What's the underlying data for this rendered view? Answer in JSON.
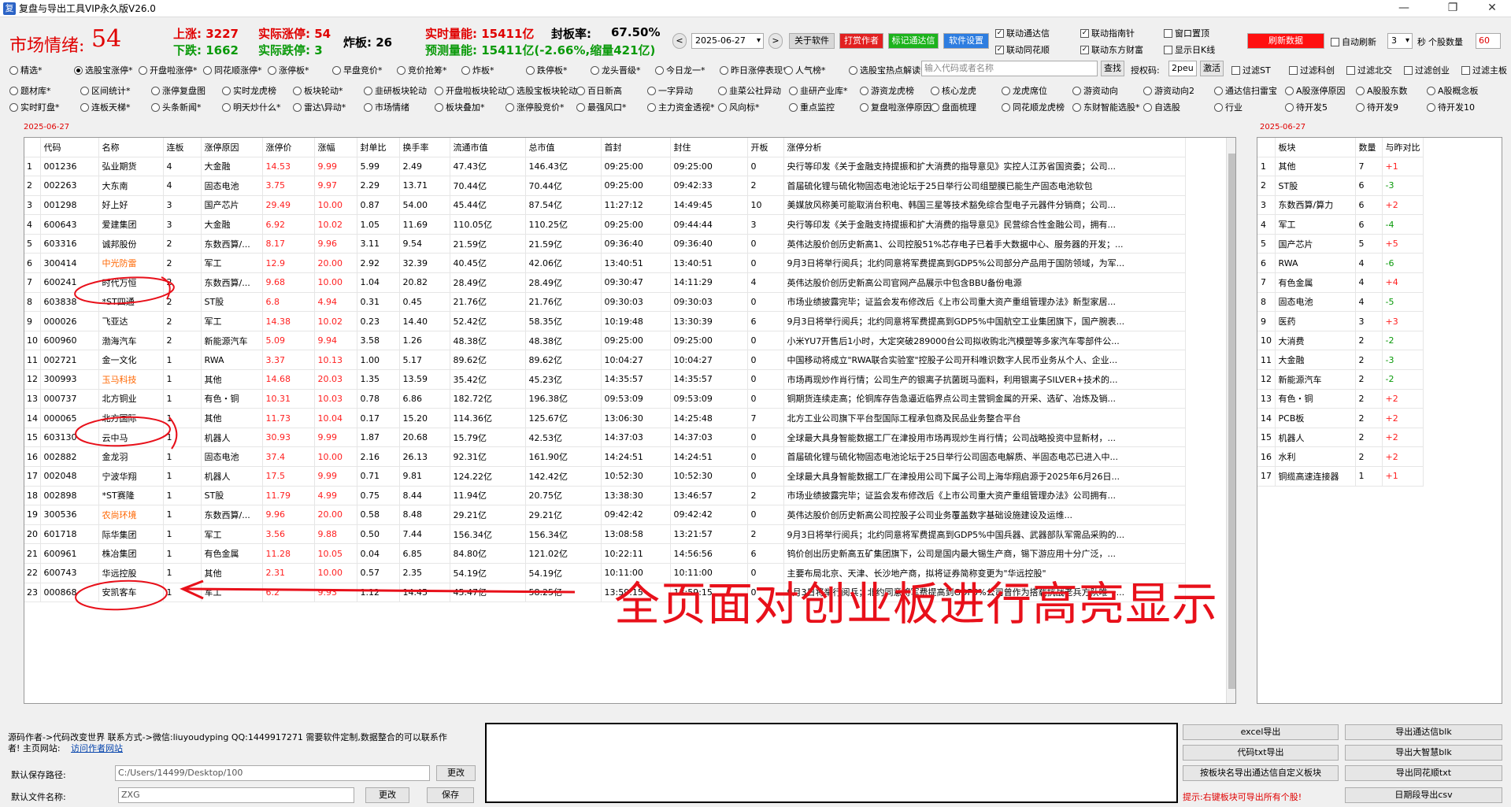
{
  "window": {
    "title": "复盘与导出工具VIP永久版V26.0",
    "controls": [
      "—",
      "❐",
      "✕"
    ]
  },
  "header": {
    "mood_label": "市场情绪:",
    "mood_value": "54",
    "up": "上涨: 3227",
    "down": "下跌: 1662",
    "real_up": "实际涨停: 54",
    "real_down": "实际跌停: 3",
    "zhaban": "炸板: 26",
    "realtime_vol": "实时量能: 15411亿",
    "seal_rate_label": "封板率:",
    "seal_rate_value": "67.50%",
    "predict_vol": "预测量能: 15411亿(-2.66%,缩量421亿)"
  },
  "toolbar": {
    "prev": "<",
    "date": "2025-06-27",
    "next": ">",
    "about": "关于软件",
    "reward": "打赏作者",
    "mark": "标记通达信",
    "settings": "软件设置",
    "cb_link_tdx": "联动通达信",
    "cb_link_znz": "联动指南针",
    "cb_top": "窗口置顶",
    "cb_link_ths": "联动同花顺",
    "cb_link_dfcf": "联动东方财富",
    "cb_kline": "显示日K线",
    "refresh": "刷新数据",
    "auto_refresh": "自动刷新",
    "interval": "3",
    "sec_label": "秒",
    "count_label": "个股数量",
    "count": "60"
  },
  "filters_row1": [
    "精选*",
    "选股宝涨停*",
    "开盘啦涨停*",
    "同花顺涨停*",
    "涨停板*",
    "早盘竞价*",
    "竞价抢筹*",
    "炸板*",
    "跌停板*",
    "龙头晋级*",
    "今日龙一*",
    "昨日涨停表现*",
    "人气榜*",
    "选股宝热点解读*"
  ],
  "search": {
    "placeholder": "输入代码或者名称",
    "button": "查找",
    "auth_label": "授权码:",
    "auth_value": "2peu",
    "activate": "激活"
  },
  "filters_cb_row1": [
    "过滤ST",
    "过滤科创",
    "过滤北交",
    "过滤创业",
    "过滤主板"
  ],
  "filters_row2": [
    "题材库*",
    "区间统计*",
    "涨停复盘图",
    "实时龙虎榜",
    "板块轮动*",
    "韭研板块轮动",
    "开盘啦板块轮动",
    "选股宝板块轮动*",
    "百日新高",
    "一字异动",
    "韭菜公社异动",
    "韭研产业库*",
    "游资龙虎榜",
    "核心龙虎",
    "龙虎席位",
    "游资动向",
    "游资动向2",
    "通达信扫雷宝",
    "A股涨停原因",
    "A股股东数",
    "A股概念板"
  ],
  "filters_row3": [
    "实时盯盘*",
    "连板天梯*",
    "头条新闻*",
    "明天炒什么*",
    "雷达\\异动*",
    "市场情绪",
    "板块叠加*",
    "涨停股竞价*",
    "最强风口*",
    "主力资金透视*",
    "风向标*",
    "重点监控",
    "复盘啦涨停原因",
    "盘面梳理",
    "同花顺龙虎榜",
    "东财智能选股*",
    "自选股",
    "行业",
    "待开发5",
    "待开发9",
    "待开发10"
  ],
  "main_table": {
    "date": "2025-06-27",
    "columns": [
      "",
      "代码",
      "名称",
      "连板",
      "涨停原因",
      "涨停价",
      "涨幅",
      "封单比",
      "换手率",
      "流通市值",
      "总市值",
      "首封",
      "封住",
      "开板",
      "涨停分析"
    ],
    "rows": [
      [
        "1",
        "001236",
        "弘业期货",
        "4",
        "大金融",
        "14.53",
        "9.99",
        "5.99",
        "2.49",
        "47.43亿",
        "146.43亿",
        "09:25:00",
        "09:25:00",
        "0",
        "央行等印发《关于金融支持提振和扩大消费的指导意见》实控人江苏省国资委；公司..."
      ],
      [
        "2",
        "002263",
        "大东南",
        "4",
        "固态电池",
        "3.75",
        "9.97",
        "2.29",
        "13.71",
        "70.44亿",
        "70.44亿",
        "09:25:00",
        "09:42:33",
        "2",
        "首届硫化锂与硫化物固态电池论坛于25日举行公司组塑膜已能生产固态电池软包"
      ],
      [
        "3",
        "001298",
        "好上好",
        "3",
        "国产芯片",
        "29.49",
        "10.00",
        "0.87",
        "54.00",
        "45.44亿",
        "87.54亿",
        "11:27:12",
        "14:49:45",
        "10",
        "美媒放风称美可能取消台积电、韩国三星等技术豁免综合型电子元器件分销商；公司..."
      ],
      [
        "4",
        "600643",
        "爱建集团",
        "3",
        "大金融",
        "6.92",
        "10.02",
        "1.05",
        "11.69",
        "110.05亿",
        "110.25亿",
        "09:25:00",
        "09:44:44",
        "3",
        "央行等印发《关于金融支持提振和扩大消费的指导意见》民营综合性金融公司，拥有..."
      ],
      [
        "5",
        "603316",
        "诚邦股份",
        "2",
        "东数西算/...",
        "8.17",
        "9.96",
        "3.11",
        "9.54",
        "21.59亿",
        "21.59亿",
        "09:36:40",
        "09:36:40",
        "0",
        "英伟达股价创历史新高1、公司控股51%芯存电子已着手大数据中心、服务器的开发；..."
      ],
      [
        "6",
        "300414",
        "中光防雷",
        "2",
        "军工",
        "12.9",
        "20.00",
        "2.92",
        "32.39",
        "40.45亿",
        "42.06亿",
        "13:40:51",
        "13:40:51",
        "0",
        "9月3日将举行阅兵；北约同意将军费提高到GDP5%公司部分产品用于国防领域，为军..."
      ],
      [
        "7",
        "600241",
        "时代万恒",
        "2",
        "东数西算/...",
        "9.68",
        "10.00",
        "1.04",
        "20.82",
        "28.49亿",
        "28.49亿",
        "09:30:47",
        "14:11:29",
        "4",
        "英伟达股价创历史新高公司官网产品展示中包含BBU备份电源"
      ],
      [
        "8",
        "603838",
        "*ST四通",
        "2",
        "ST股",
        "6.8",
        "4.94",
        "0.31",
        "0.45",
        "21.76亿",
        "21.76亿",
        "09:30:03",
        "09:30:03",
        "0",
        "市场业绩披露完毕；证监会发布修改后《上市公司重大资产重组管理办法》新型家居..."
      ],
      [
        "9",
        "000026",
        "飞亚达",
        "2",
        "军工",
        "14.38",
        "10.02",
        "0.23",
        "14.40",
        "52.42亿",
        "58.35亿",
        "10:19:48",
        "13:30:39",
        "6",
        "9月3日将举行阅兵；北约同意将军费提高到GDP5%中国航空工业集团旗下，国产腕表..."
      ],
      [
        "10",
        "600960",
        "渤海汽车",
        "2",
        "新能源汽车",
        "5.09",
        "9.94",
        "3.58",
        "1.26",
        "48.38亿",
        "48.38亿",
        "09:25:00",
        "09:25:00",
        "0",
        "小米YU7开售后1小时，大定突破289000台公司拟收购北汽模塑等多家汽车零部件公..."
      ],
      [
        "11",
        "002721",
        "金一文化",
        "1",
        "RWA",
        "3.37",
        "10.13",
        "1.00",
        "5.17",
        "89.62亿",
        "89.62亿",
        "10:04:27",
        "10:04:27",
        "0",
        "中国移动将成立\"RWA联合实验室\"控股子公司开科唯识数字人民币业务从个人、企业..."
      ],
      [
        "12",
        "300993",
        "玉马科技",
        "1",
        "其他",
        "14.68",
        "20.03",
        "1.35",
        "13.59",
        "35.42亿",
        "45.23亿",
        "14:35:57",
        "14:35:57",
        "0",
        "市场再现炒作肖行情；公司生产的银离子抗菌斑马面料，利用银离子SILVER+技术的..."
      ],
      [
        "13",
        "000737",
        "北方铜业",
        "1",
        "有色・铜",
        "10.31",
        "10.03",
        "0.78",
        "6.86",
        "182.72亿",
        "196.38亿",
        "09:53:09",
        "09:53:09",
        "0",
        "铜期货连续走高；伦铜库存告急逼近临界点公司主营铜金属的开采、选矿、冶炼及销..."
      ],
      [
        "14",
        "000065",
        "北方国际",
        "1",
        "其他",
        "11.73",
        "10.04",
        "0.17",
        "15.20",
        "114.36亿",
        "125.67亿",
        "13:06:30",
        "14:25:48",
        "7",
        "北方工业公司旗下平台型国际工程承包商及民品业务整合平台"
      ],
      [
        "15",
        "603130",
        "云中马",
        "1",
        "机器人",
        "30.93",
        "9.99",
        "1.87",
        "20.68",
        "15.79亿",
        "42.53亿",
        "14:37:03",
        "14:37:03",
        "0",
        "全球最大具身智能数据工厂在津投用市场再现炒生肖行情；公司战略投资中显新材，..."
      ],
      [
        "16",
        "002882",
        "金龙羽",
        "1",
        "固态电池",
        "37.4",
        "10.00",
        "2.16",
        "26.13",
        "92.31亿",
        "161.90亿",
        "14:24:51",
        "14:24:51",
        "0",
        "首届硫化锂与硫化物固态电池论坛于25日举行公司固态电解质、半固态电芯已进入中..."
      ],
      [
        "17",
        "002048",
        "宁波华翔",
        "1",
        "机器人",
        "17.5",
        "9.99",
        "0.71",
        "9.81",
        "124.22亿",
        "142.42亿",
        "10:52:30",
        "10:52:30",
        "0",
        "全球最大具身智能数据工厂在津投用公司下属子公司上海华翔启源于2025年6月26日..."
      ],
      [
        "18",
        "002898",
        "*ST赛隆",
        "1",
        "ST股",
        "11.79",
        "4.99",
        "0.75",
        "8.44",
        "11.94亿",
        "20.75亿",
        "13:38:30",
        "13:46:57",
        "2",
        "市场业绩披露完毕；证监会发布修改后《上市公司重大资产重组管理办法》公司拥有..."
      ],
      [
        "19",
        "300536",
        "农尚环境",
        "1",
        "东数西算/...",
        "9.96",
        "20.00",
        "0.58",
        "8.48",
        "29.21亿",
        "29.21亿",
        "09:42:42",
        "09:42:42",
        "0",
        "英伟达股价创历史新高公司控股子公司业务覆盖数字基础设施建设及运维..."
      ],
      [
        "20",
        "601718",
        "际华集团",
        "1",
        "军工",
        "3.56",
        "9.88",
        "0.50",
        "7.44",
        "156.34亿",
        "156.34亿",
        "13:08:58",
        "13:21:57",
        "2",
        "9月3日将举行阅兵；北约同意将军费提高到GDP5%中国兵器、武器部队军需品采购的..."
      ],
      [
        "21",
        "600961",
        "株冶集团",
        "1",
        "有色金属",
        "11.28",
        "10.05",
        "0.04",
        "6.85",
        "84.80亿",
        "121.02亿",
        "10:22:11",
        "14:56:56",
        "6",
        "钨价创出历史新高五矿集团旗下，公司是国内最大锡生产商，锡下游应用十分广泛，..."
      ],
      [
        "22",
        "600743",
        "华远控股",
        "1",
        "其他",
        "2.31",
        "10.00",
        "0.57",
        "2.35",
        "54.19亿",
        "54.19亿",
        "10:11:00",
        "10:11:00",
        "0",
        "主要布局北京、天津、长沙地产商，拟将证券简称变更为\"华远控股\""
      ],
      [
        "23",
        "000868",
        "安凯客车",
        "1",
        "军工",
        "6.2",
        "9.93",
        "1.12",
        "14.45",
        "45.47亿",
        "58.25亿",
        "13:59:15",
        "13:59:15",
        "0",
        "9月3日将举行阅兵；北约同意将军费提高到GDP5%公司曾作为搭载抗战老兵方队唯一..."
      ]
    ],
    "orange_rows": [
      6,
      12,
      19
    ]
  },
  "sector_table": {
    "date": "2025-06-27",
    "columns": [
      "",
      "板块",
      "数量",
      "与昨对比"
    ],
    "rows": [
      [
        "1",
        "其他",
        "7",
        "+1"
      ],
      [
        "2",
        "ST股",
        "6",
        "-3"
      ],
      [
        "3",
        "东数西算/算力",
        "6",
        "+2"
      ],
      [
        "4",
        "军工",
        "6",
        "-4"
      ],
      [
        "5",
        "国产芯片",
        "5",
        "+5"
      ],
      [
        "6",
        "RWA",
        "4",
        "-6"
      ],
      [
        "7",
        "有色金属",
        "4",
        "+4"
      ],
      [
        "8",
        "固态电池",
        "4",
        "-5"
      ],
      [
        "9",
        "医药",
        "3",
        "+3"
      ],
      [
        "10",
        "大消费",
        "2",
        "-2"
      ],
      [
        "11",
        "大金融",
        "2",
        "-3"
      ],
      [
        "12",
        "新能源汽车",
        "2",
        "-2"
      ],
      [
        "13",
        "有色・铜",
        "2",
        "+2"
      ],
      [
        "14",
        "PCB板",
        "2",
        "+2"
      ],
      [
        "15",
        "机器人",
        "2",
        "+2"
      ],
      [
        "16",
        "水利",
        "2",
        "+2"
      ],
      [
        "17",
        "铜缆高速连接器",
        "1",
        "+1"
      ]
    ]
  },
  "annotation": {
    "text": "全页面对创业板进行高亮显示"
  },
  "footer": {
    "author_line": "源码作者->代码改变世界 联系方式->微信:liuyoudyping QQ:1449917271 需要软件定制,数据整合的可以联系作",
    "author_line2": "者! 主页网站:",
    "site_link": "访问作者网站",
    "save_path_label": "默认保存路径:",
    "save_path_value": "C:/Users/14499/Desktop/100",
    "change1": "更改",
    "file_name_label": "默认文件名称:",
    "file_name_value": "ZXG",
    "change2": "更改",
    "save": "保存",
    "btn_excel": "excel导出",
    "btn_tdx_blk": "导出通达信blk",
    "btn_code_txt": "代码txt导出",
    "btn_dzh_blk": "导出大智慧blk",
    "btn_sector_tdx": "按板块名导出通达信自定义板块",
    "btn_ths_txt": "导出同花顺txt",
    "tip": "提示:右键板块可导出所有个股!",
    "btn_daily_csv": "日期段导出csv"
  },
  "colors": {
    "red": "#e00000",
    "green": "#0a9a0a",
    "annotation": "#e8101a",
    "highlight": "#ff6600"
  }
}
